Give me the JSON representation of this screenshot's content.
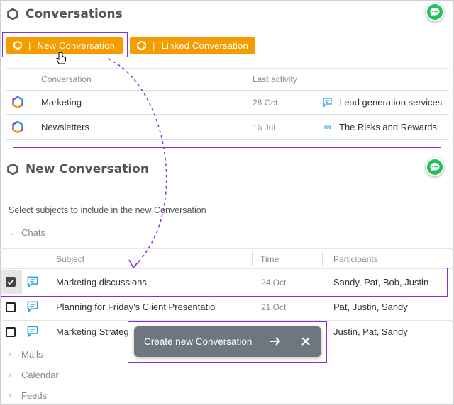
{
  "conversations": {
    "title": "Conversations",
    "new_button": "New Conversation",
    "linked_button": "Linked Conversation",
    "columns": [
      "Conversation",
      "Last activity"
    ],
    "rows": [
      {
        "name": "Marketing",
        "date": "28 Oct",
        "linked": "Lead generation services",
        "linked_icon": "chat-icon"
      },
      {
        "name": "Newsletters",
        "date": "16 Jul",
        "linked": "The Risks and Rewards",
        "linked_icon": "rw-icon"
      }
    ]
  },
  "new_conversation": {
    "title": "New Conversation",
    "instruction": "Select subjects to include in the new Conversation",
    "groups": [
      "Chats",
      "Mails",
      "Calendar",
      "Feeds"
    ],
    "columns": [
      "Subject",
      "Time",
      "Participants"
    ],
    "rows": [
      {
        "subject": "Marketing discussions",
        "time": "24 Oct",
        "participants": "Sandy, Pat, Bob, Justin",
        "checked": true
      },
      {
        "subject": "Planning for Friday's Client Presentatio",
        "time": "21 Oct",
        "participants": "Pat, Justin, Sandy",
        "checked": false
      },
      {
        "subject": "Marketing Strateg",
        "time": "",
        "participants": "Justin, Pat, Sandy",
        "checked": false
      }
    ]
  },
  "toast": {
    "label": "Create new Conversation"
  },
  "colors": {
    "accent": "#f59c00",
    "highlight": "#8a2be2",
    "chat_green": "#21c25e",
    "toast_bg": "#6e7780"
  },
  "badges": {
    "rw": "rw"
  }
}
